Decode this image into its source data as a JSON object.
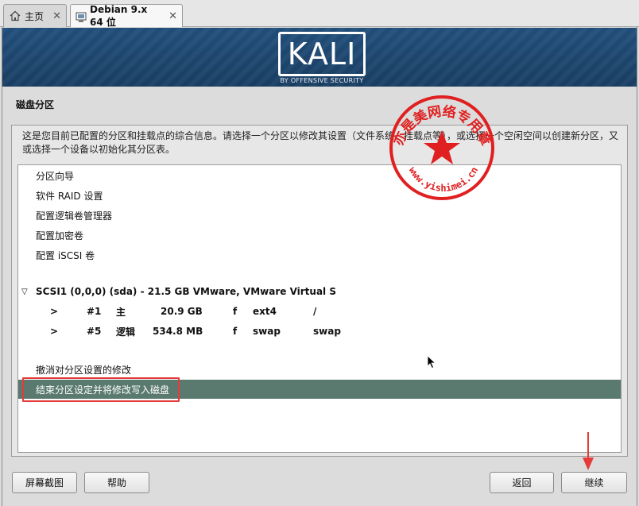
{
  "tabs": [
    {
      "label": "主页",
      "icon": "home-icon"
    },
    {
      "label": "Debian 9.x 64 位",
      "icon": "vm-icon"
    }
  ],
  "banner": {
    "logo_text": "KALI",
    "tagline": "BY OFFENSIVE SECURITY"
  },
  "page": {
    "title": "磁盘分区",
    "intro": "这是您目前已配置的分区和挂载点的综合信息。请选择一个分区以修改其设置（文件系统、挂载点等），或选择一个空闲空间以创建新分区，又或选择一个设备以初始化其分区表。"
  },
  "list": {
    "items": [
      {
        "label": "分区向导"
      },
      {
        "label": "软件 RAID 设置"
      },
      {
        "label": "配置逻辑卷管理器"
      },
      {
        "label": "配置加密卷"
      },
      {
        "label": "配置 iSCSI 卷"
      }
    ],
    "disk": {
      "expander": "▽",
      "label": "SCSI1 (0,0,0) (sda) - 21.5 GB VMware, VMware Virtual S"
    },
    "partitions": [
      {
        "arrow": ">",
        "num": "#1",
        "type": "主",
        "size": "20.9 GB",
        "flag": "f",
        "fs": "ext4",
        "mount": "/"
      },
      {
        "arrow": ">",
        "num": "#5",
        "type": "逻辑",
        "size": "534.8 MB",
        "flag": "f",
        "fs": "swap",
        "mount": "swap"
      }
    ],
    "undo": "撤消对分区设置的修改",
    "finish": "结束分区设定并将修改写入磁盘"
  },
  "stamp": {
    "text": "亦是美网络专用章",
    "url": "www.yishimei.cn",
    "color": "#e02020"
  },
  "buttons": {
    "screenshot": "屏幕截图",
    "help": "帮助",
    "back": "返回",
    "continue": "继续"
  },
  "colors": {
    "selected_row": "#5a7a70",
    "banner": "#22507d",
    "annotation": "#e53b3b"
  }
}
